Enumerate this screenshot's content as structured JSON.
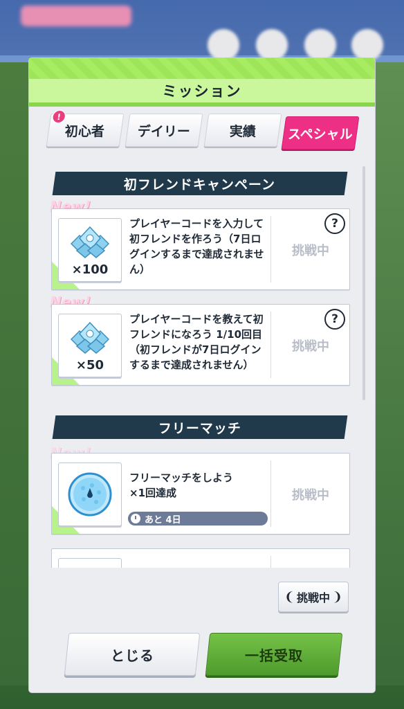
{
  "dialog": {
    "title": "ミッション"
  },
  "tabs": [
    {
      "label": "初心者",
      "badge": "!"
    },
    {
      "label": "デイリー"
    },
    {
      "label": "実績"
    },
    {
      "label": "スペシャル",
      "active": true
    }
  ],
  "sections": [
    {
      "title": "初フレンドキャンペーン",
      "missions": [
        {
          "new_tag": "New!",
          "reward_icon": "gem-icon",
          "reward_qty": "×100",
          "description": "プレイヤーコードを入力して初フレンドを作ろう（7日ログインするまで達成されません）",
          "status": "挑戦中",
          "help": "?"
        },
        {
          "new_tag": "New!",
          "reward_icon": "gem-icon",
          "reward_qty": "×50",
          "description": "プレイヤーコードを教えて初フレンドになろう 1/10回目（初フレンドが7日ログインするまで達成されません）",
          "status": "挑戦中",
          "help": "?"
        }
      ]
    },
    {
      "title": "フリーマッチ",
      "missions": [
        {
          "new_tag": "New!",
          "reward_icon": "golf-ball-icon",
          "description": "フリーマッチをしよう\n×1回達成",
          "timer": "あと 4日",
          "status": "挑戦中"
        }
      ]
    }
  ],
  "filter_button": {
    "label": "挑戦中"
  },
  "buttons": {
    "close": "とじる",
    "claim_all": "一括受取"
  },
  "colors": {
    "accent_green": "#9fe55a",
    "active_tab": "#ee2f86",
    "section_header": "#203a4c"
  }
}
